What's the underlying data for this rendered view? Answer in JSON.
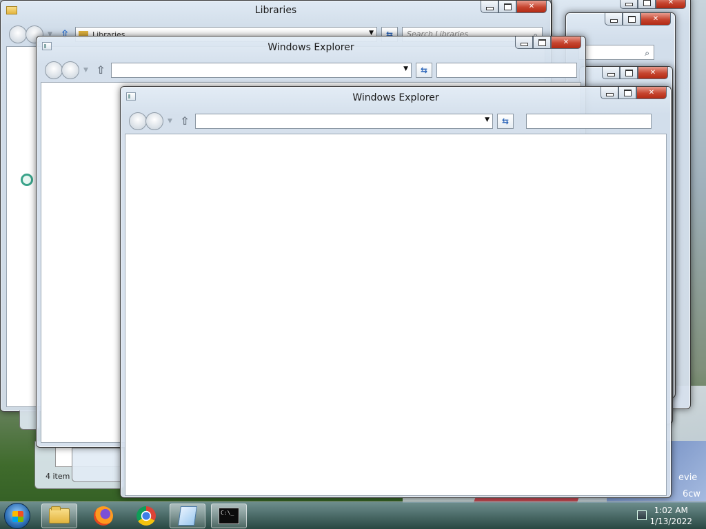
{
  "desktop": {
    "colors": {
      "taskbar": "#2f5050",
      "close_button": "#c6452f"
    }
  },
  "windows": {
    "back3": {
      "icon": "caption-close-icon"
    },
    "back2": {
      "icon": "caption-close-icon"
    },
    "libraries": {
      "title": "Libraries",
      "address": "Libraries",
      "search_placeholder": "Search Libraries",
      "status": "4 item"
    },
    "explorer1": {
      "title": "Windows Explorer",
      "address": ""
    },
    "explorer2": {
      "title": "Windows Explorer",
      "address": ""
    }
  },
  "taskbar": {
    "items": [
      "Windows Explorer",
      "Firefox",
      "Google Chrome",
      "Notes",
      "Command Prompt"
    ],
    "cmd_text": "C:\\_",
    "clock_time": "1:02 AM",
    "clock_date": "1/13/2022"
  },
  "wallpaper_fragments": [
    "evie",
    "6cw"
  ]
}
